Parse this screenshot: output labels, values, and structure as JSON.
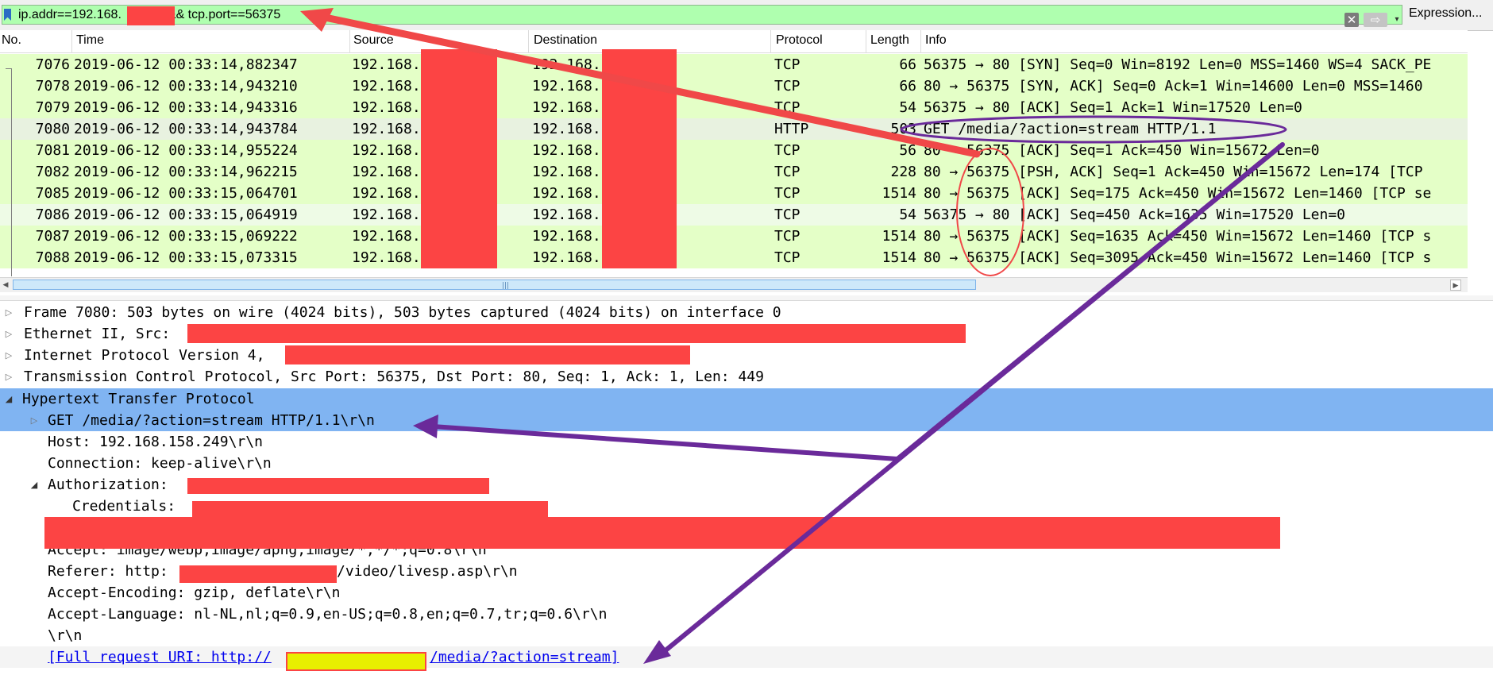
{
  "filter": {
    "part1": "ip.addr==192.168.",
    "part2": "&& tcp.port==56375",
    "expression_label": "Expression...",
    "clear_icon": "✕",
    "apply_icon": "⇨",
    "dropdown_icon": "▾"
  },
  "columns": [
    "No.",
    "Time",
    "Source",
    "Destination",
    "Protocol",
    "Length",
    "Info"
  ],
  "packets": [
    {
      "no": "7076",
      "time": "2019-06-12 00:33:14,882347",
      "src": "192.168.",
      "dst": "192.168.",
      "proto": "TCP",
      "len": "66",
      "info": "56375 → 80 [SYN] Seq=0 Win=8192 Len=0 MSS=1460 WS=4 SACK_PE",
      "bg": "#e4ffc7"
    },
    {
      "no": "7078",
      "time": "2019-06-12 00:33:14,943210",
      "src": "192.168.",
      "dst": "192.168.",
      "proto": "TCP",
      "len": "66",
      "info": "80 → 56375 [SYN, ACK] Seq=0 Ack=1 Win=14600 Len=0 MSS=1460",
      "bg": "#e4ffc7"
    },
    {
      "no": "7079",
      "time": "2019-06-12 00:33:14,943316",
      "src": "192.168.",
      "dst": "192.168.",
      "proto": "TCP",
      "len": "54",
      "info": "56375 → 80 [ACK] Seq=1 Ack=1 Win=17520 Len=0",
      "bg": "#e4ffc7"
    },
    {
      "no": "7080",
      "time": "2019-06-12 00:33:14,943784",
      "src": "192.168.",
      "dst": "192.168.",
      "proto": "HTTP",
      "len": "503",
      "info": "GET /media/?action=stream HTTP/1.1",
      "bg": "#e8f2e0"
    },
    {
      "no": "7081",
      "time": "2019-06-12 00:33:14,955224",
      "src": "192.168.",
      "dst": "192.168.",
      "proto": "TCP",
      "len": "56",
      "info": "80 → 56375 [ACK] Seq=1 Ack=450 Win=15672 Len=0",
      "bg": "#e4ffc7"
    },
    {
      "no": "7082",
      "time": "2019-06-12 00:33:14,962215",
      "src": "192.168.",
      "dst": "192.168.",
      "proto": "TCP",
      "len": "228",
      "info": "80 → 56375 [PSH, ACK] Seq=1 Ack=450 Win=15672 Len=174 [TCP",
      "bg": "#e4ffc7"
    },
    {
      "no": "7085",
      "time": "2019-06-12 00:33:15,064701",
      "src": "192.168.",
      "dst": "192.168.",
      "proto": "TCP",
      "len": "1514",
      "info": "80 → 56375 [ACK] Seq=175 Ack=450 Win=15672 Len=1460 [TCP se",
      "bg": "#e4ffc7"
    },
    {
      "no": "7086",
      "time": "2019-06-12 00:33:15,064919",
      "src": "192.168.",
      "dst": "192.168.",
      "proto": "TCP",
      "len": "54",
      "info": "56375 → 80 [ACK] Seq=450 Ack=1635 Win=17520 Len=0",
      "bg": "#eefbe6"
    },
    {
      "no": "7087",
      "time": "2019-06-12 00:33:15,069222",
      "src": "192.168.",
      "dst": "192.168.",
      "proto": "TCP",
      "len": "1514",
      "info": "80 → 56375 [ACK] Seq=1635 Ack=450 Win=15672 Len=1460 [TCP s",
      "bg": "#e4ffc7"
    },
    {
      "no": "7088",
      "time": "2019-06-12 00:33:15,073315",
      "src": "192.168.",
      "dst": "192.168.",
      "proto": "TCP",
      "len": "1514",
      "info": "80 → 56375 [ACK] Seq=3095 Ack=450 Win=15672 Len=1460 [TCP s",
      "bg": "#e4ffc7"
    }
  ],
  "details": [
    {
      "text": "Frame 7080: 503 bytes on wire (4024 bits), 503 bytes captured (4024 bits) on interface 0",
      "twist": "▷",
      "indent": 0
    },
    {
      "text": "Ethernet II, Src:",
      "twist": "▷",
      "indent": 0
    },
    {
      "text": "Internet Protocol Version 4,",
      "twist": "▷",
      "indent": 0
    },
    {
      "text": "Transmission Control Protocol, Src Port: 56375, Dst Port: 80, Seq: 1, Ack: 1, Len: 449",
      "twist": "▷",
      "indent": 0
    },
    {
      "text": "Hypertext Transfer Protocol",
      "twist": "◢",
      "indent": 0,
      "highlight": true
    },
    {
      "text": "GET /media/?action=stream HTTP/1.1\\r\\n",
      "twist": "▷",
      "indent": 1,
      "highlight": true
    },
    {
      "text": "Host: 192.168.158.249\\r\\n",
      "twist": "",
      "indent": 1
    },
    {
      "text": "Connection: keep-alive\\r\\n",
      "twist": "",
      "indent": 1
    },
    {
      "text": "Authorization:",
      "twist": "◢",
      "indent": 1
    },
    {
      "text": "Credentials:",
      "twist": "",
      "indent": 2
    },
    {
      "text": "",
      "twist": "",
      "indent": 1
    },
    {
      "text": "Accept: image/webp,image/apng,image/*,*/*;q=0.8\\r\\n",
      "twist": "",
      "indent": 1
    },
    {
      "text": "Referer: http:",
      "twist": "",
      "indent": 1,
      "suffix": "/video/livesp.asp\\r\\n"
    },
    {
      "text": "Accept-Encoding: gzip, deflate\\r\\n",
      "twist": "",
      "indent": 1
    },
    {
      "text": "Accept-Language: nl-NL,nl;q=0.9,en-US;q=0.8,en;q=0.7,tr;q=0.6\\r\\n",
      "twist": "",
      "indent": 1
    },
    {
      "text": "\\r\\n",
      "twist": "",
      "indent": 1
    },
    {
      "text": "[Full request URI: http://",
      "twist": "",
      "indent": 1,
      "link": true,
      "suffix": "/media/?action=stream]"
    }
  ],
  "colors": {
    "filter_bg": "#afffaf",
    "tcp_row": "#e4ffc7",
    "selection": "#80b4f2",
    "redaction": "#fc4444",
    "annotation_red": "#f04848",
    "annotation_purple": "#6a2a9a"
  }
}
